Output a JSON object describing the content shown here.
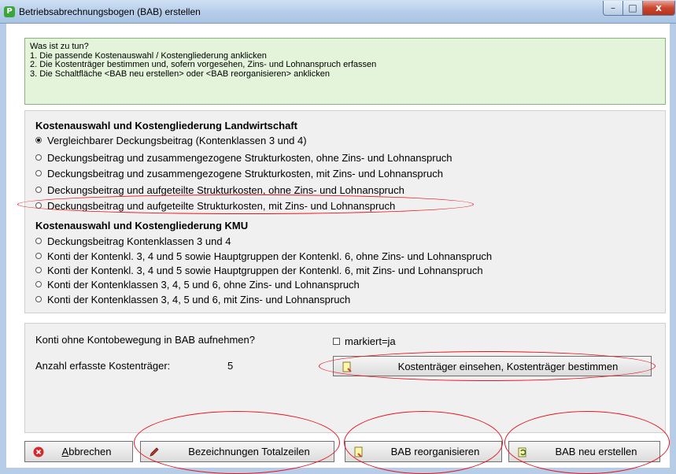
{
  "window": {
    "title": "Betriebsabrechnungsbogen (BAB) erstellen",
    "controls": {
      "minimize": "–",
      "maximize": "□",
      "close": "x"
    }
  },
  "instructions": {
    "lines": [
      "Was ist zu tun?",
      "1. Die passende Kostenauswahl / Kostengliederung anklicken",
      "2. Die Kostenträger bestimmen und, sofern vorgesehen, Zins- und Lohnanspruch erfassen",
      "3. Die Schaltfläche <BAB neu erstellen> oder <BAB reorganisieren> anklicken"
    ]
  },
  "landwirtschaft": {
    "title": "Kostenauswahl und Kostengliederung Landwirtschaft",
    "options": [
      "Vergleichbarer Deckungsbeitrag (Kontenklassen 3 und 4)",
      "Deckungsbeitrag und zusammengezogene Strukturkosten, ohne Zins- und Lohnanspruch",
      "Deckungsbeitrag und zusammengezogene Strukturkosten, mit Zins- und Lohnanspruch",
      "Deckungsbeitrag und aufgeteilte Strukturkosten, ohne Zins- und Lohnanspruch",
      "Deckungsbeitrag und aufgeteilte Strukturkosten, mit Zins- und Lohnanspruch"
    ],
    "selected_index": 0
  },
  "kmu": {
    "title": "Kostenauswahl und Kostengliederung KMU",
    "options": [
      "Deckungsbeitrag Kontenklassen 3 und 4",
      "Konti der Kontenkl. 3, 4 und 5 sowie Hauptgruppen der Kontenkl. 6, ohne Zins- und Lohnanspruch",
      "Konti der Kontenkl. 3, 4 und 5 sowie Hauptgruppen der Kontenkl. 6, mit Zins- und Lohnanspruch",
      "Konti der Kontenklassen 3, 4, 5 und 6, ohne Zins- und Lohnanspruch",
      "Konti der Kontenklassen 3, 4, 5 und 6, mit Zins- und Lohnanspruch"
    ]
  },
  "settings": {
    "konti_question": "Konti ohne Kontobewegung in BAB aufnehmen?",
    "checkbox_label": "markiert=ja",
    "checkbox_checked": false,
    "count_label": "Anzahl erfasste Kostenträger:",
    "count_value": "5",
    "kostentraeger_button": "Kostenträger einsehen, Kostenträger bestimmen"
  },
  "buttons": {
    "cancel": "Abbrechen",
    "labels": "Bezeichnungen Totalzeilen",
    "reorganize": "BAB reorganisieren",
    "create": "BAB neu erstellen"
  },
  "colors": {
    "annotation_oval": "#e8141e",
    "instruction_bg": "#e3f4da",
    "panel_bg": "#f0f0f0",
    "titlebar": "#b5cde9"
  },
  "icons": [
    "app-icon",
    "cancel-icon",
    "pencil-icon",
    "document-icon",
    "refresh-icon"
  ]
}
